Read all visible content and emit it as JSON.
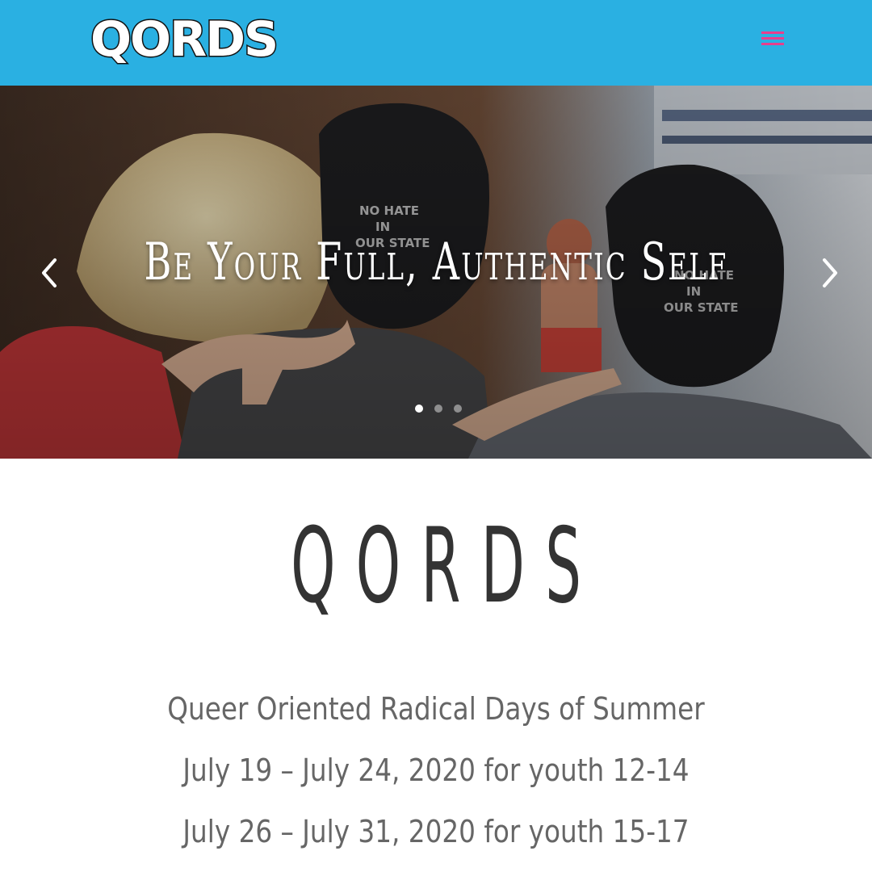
{
  "header": {
    "logo_text": "QORDS",
    "menu_icon": "hamburger-menu-icon",
    "background_color": "#2ab0e2",
    "menu_color": "#e83e8c"
  },
  "hero": {
    "title": "Be Your Full, Authentic Self",
    "prev_icon": "chevron-left-icon",
    "next_icon": "chevron-right-icon",
    "slide_count": 3,
    "active_slide": 1,
    "hat_text_1": "NO HATE\nIN\nOUR STATE",
    "hat_text_2": "NO HATE\nIN\nOUR STATE"
  },
  "main": {
    "title": "QORDS",
    "tagline": "Queer Oriented Radical Days of Summer",
    "dates": [
      "July 19 – July 24, 2020 for youth 12-14",
      "July 26 – July 31, 2020 for youth 15-17"
    ]
  }
}
